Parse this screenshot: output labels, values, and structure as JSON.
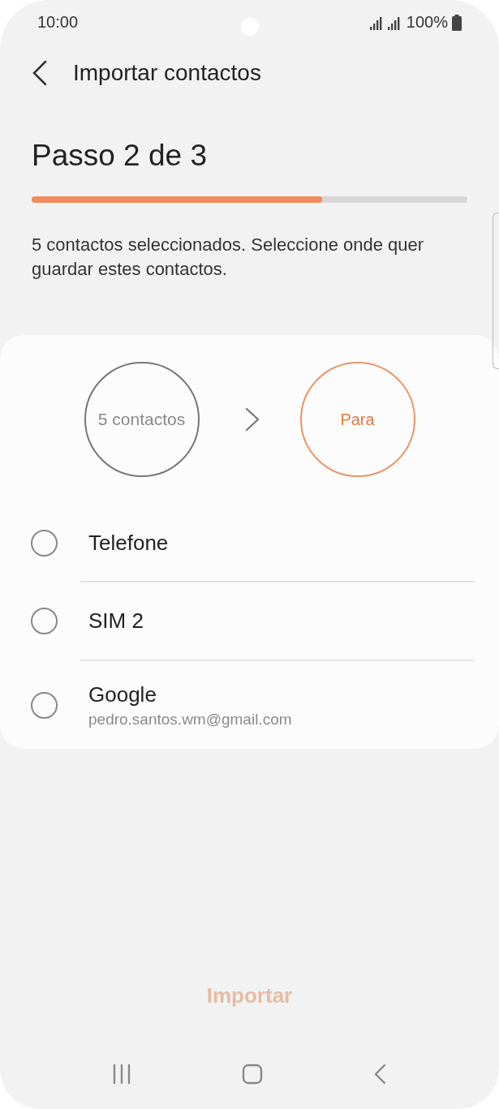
{
  "status_bar": {
    "time": "10:00",
    "battery": "100%"
  },
  "header": {
    "title": "Importar contactos"
  },
  "step": {
    "title": "Passo 2 de 3",
    "level": 0.667
  },
  "description": "5 contactos seleccionados. Seleccione onde quer guardar estes contactos.",
  "flow": [
    {
      "label": "5 contactos",
      "selected": false
    },
    {
      "label": "Para",
      "selected": true
    }
  ],
  "options": [
    {
      "label": "Telefone",
      "selected": false
    },
    {
      "label": "SIM 2",
      "selected": false
    },
    {
      "label": "Google",
      "account": "pedro.santos.wm@gmail.com",
      "selected": false
    }
  ],
  "import_button": {
    "label": "Importar",
    "disabled": true
  }
}
